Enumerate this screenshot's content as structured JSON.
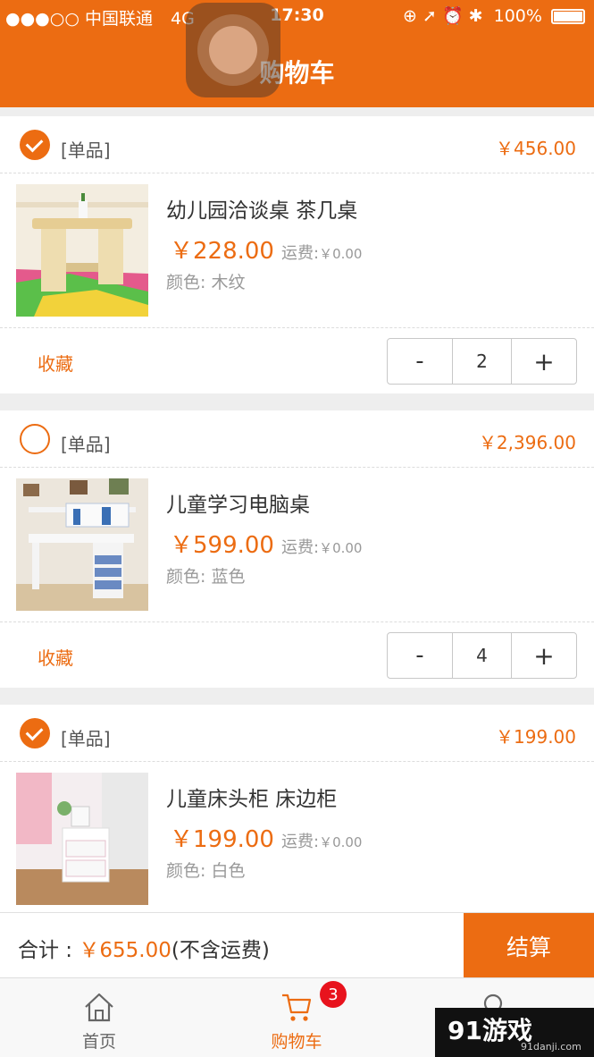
{
  "status_bar": {
    "signal": "●●●○○",
    "carrier": "中国联通",
    "network": "4G",
    "time": "17:30",
    "indicators": "⊕ ➚ ⏰ ✱",
    "battery": "100%"
  },
  "header": {
    "title": "购物车"
  },
  "items": [
    {
      "checked": true,
      "tag": "[单品]",
      "subtotal": "￥456.00",
      "name": "幼儿园洽谈桌 茶几桌",
      "price": "￥228.00",
      "shipping_label": "运费:",
      "shipping_value": "￥0.00",
      "color": "颜色: 木纹",
      "favorite": "收藏",
      "minus": "-",
      "quantity": "2",
      "plus": "+"
    },
    {
      "checked": false,
      "tag": "[单品]",
      "subtotal": "￥2,396.00",
      "name": "儿童学习电脑桌",
      "price": "￥599.00",
      "shipping_label": "运费:",
      "shipping_value": "￥0.00",
      "color": "颜色: 蓝色",
      "favorite": "收藏",
      "minus": "-",
      "quantity": "4",
      "plus": "+"
    },
    {
      "checked": true,
      "tag": "[单品]",
      "subtotal": "￥199.00",
      "name": "儿童床头柜 床边柜",
      "price": "￥199.00",
      "shipping_label": "运费:",
      "shipping_value": "￥0.00",
      "color": "颜色: 白色"
    }
  ],
  "checkout": {
    "total_label": "合计 : ",
    "total_amount": "￥655.00",
    "total_note": "(不含运费)",
    "pay_button": "结算"
  },
  "tabbar": {
    "home": "首页",
    "cart": "购物车",
    "cart_badge": "3"
  },
  "watermark": {
    "logo_num": "91",
    "logo_text": "游戏",
    "url": "91danji.com"
  },
  "colors": {
    "accent": "#ec6c12",
    "badge": "#e8131d"
  }
}
